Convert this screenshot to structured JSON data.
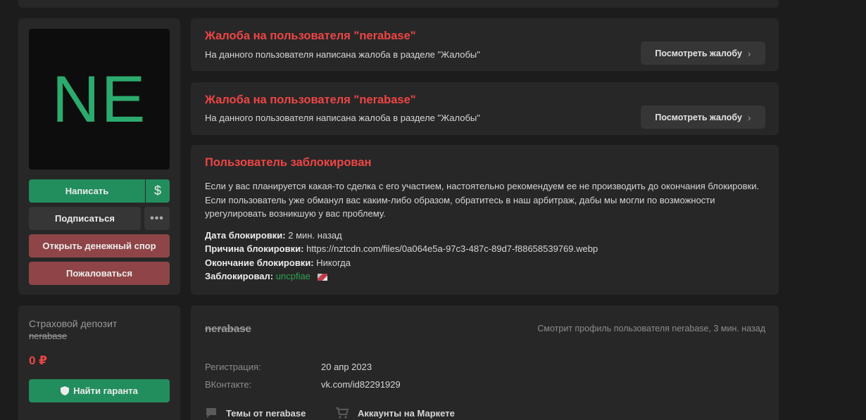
{
  "profile": {
    "avatar_initials": "NE",
    "buttons": {
      "write": "Написать",
      "dollar": "$",
      "subscribe": "Подписаться",
      "more": "•••",
      "open_dispute": "Открыть денежный спор",
      "report": "Пожаловаться"
    }
  },
  "complaints": [
    {
      "title": "Жалоба на пользователя \"nerabase\"",
      "text": "На данного пользователя написана жалоба в разделе \"Жалобы\"",
      "button": "Посмотреть жалобу"
    },
    {
      "title": "Жалоба на пользователя \"nerabase\"",
      "text": "На данного пользователя написана жалоба в разделе \"Жалобы\"",
      "button": "Посмотреть жалобу"
    }
  ],
  "ban": {
    "title": "Пользователь заблокирован",
    "description": "Если у вас планируется какая-то сделка с его участием, настоятельно рекомендуем ее не производить до окончания блокировки. Если пользователь уже обманул вас каким-либо образом, обратитесь в наш арбитраж, дабы мы могли по возможности урегулировать возникшую у вас проблему.",
    "date_label": "Дата блокировки:",
    "date_value": "2 мин. назад",
    "reason_label": "Причина блокировки:",
    "reason_value": "https://nztcdn.com/files/0a064e5a-97c3-487c-89d7-f88658539769.webp",
    "end_label": "Окончание блокировки:",
    "end_value": "Никогда",
    "by_label": "Заблокировал:",
    "by_value": "uncpfiae"
  },
  "deposit": {
    "label": "Страховой депозит",
    "username": "nerabase",
    "amount": "0 ₽",
    "button": "Найти гаранта"
  },
  "info": {
    "username": "nerabase",
    "viewing": "Смотрит профиль пользователя nerabase, 3 мин. назад",
    "registration_label": "Регистрация:",
    "registration_value": "20 апр 2023",
    "vk_label": "ВКонтакте:",
    "vk_value": "vk.com/id82291929",
    "topics_link": "Темы от nerabase",
    "market_link": "Аккаунты на Маркете"
  },
  "colors": {
    "accent_green": "#228e5d",
    "danger_red": "#ee4545",
    "button_red": "#8f4547",
    "avatar_text": "#2bab6d"
  }
}
